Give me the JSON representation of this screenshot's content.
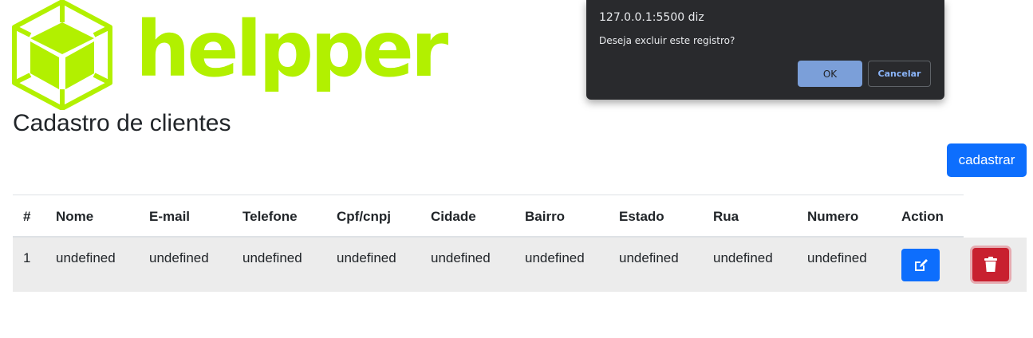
{
  "brand": {
    "logo_text": "helpper",
    "logo_icon": "cube-icon",
    "color": "#b2f000"
  },
  "page_title": "Cadastro de clientes",
  "actions": {
    "cadastrar_label": "cadastrar"
  },
  "table": {
    "headers": [
      "#",
      "Nome",
      "E-mail",
      "Telefone",
      "Cpf/cnpj",
      "Cidade",
      "Bairro",
      "Estado",
      "Rua",
      "Numero",
      "Action"
    ],
    "rows": [
      [
        "1",
        "undefined",
        "undefined",
        "undefined",
        "undefined",
        "undefined",
        "undefined",
        "undefined",
        "undefined",
        "undefined"
      ]
    ],
    "row_actions": {
      "edit_icon": "edit-icon",
      "delete_icon": "trash-icon"
    }
  },
  "dialog": {
    "origin": "127.0.0.1:5500 diz",
    "message": "Deseja excluir este registro?",
    "ok_label": "OK",
    "cancel_label": "Cancelar"
  },
  "colors": {
    "primary": "#0d6efd",
    "danger": "#c8202f",
    "dialog_bg": "#292a2d"
  }
}
